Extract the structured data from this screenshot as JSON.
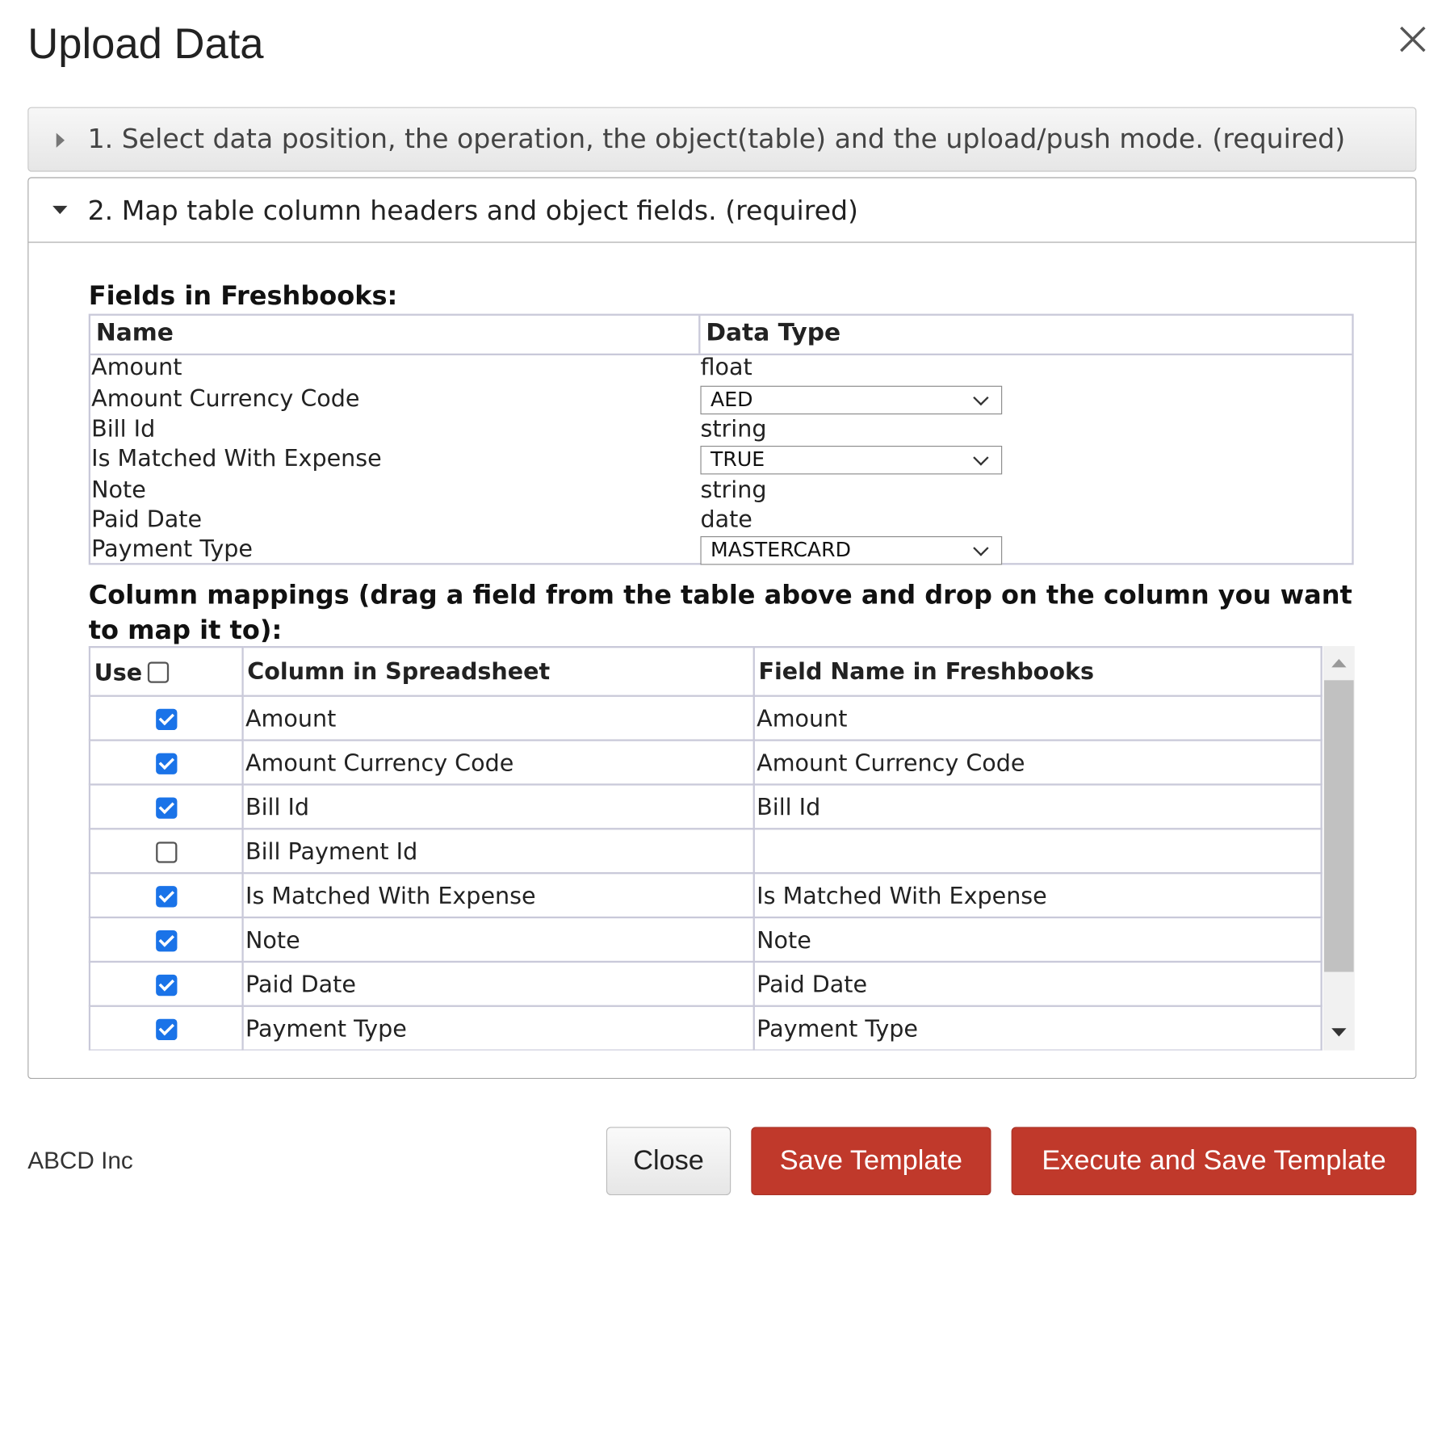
{
  "dialog": {
    "title": "Upload Data"
  },
  "steps": [
    {
      "label": "1. Select data position, the operation, the object(table) and the upload/push mode. (required)",
      "expanded": false
    },
    {
      "label": "2. Map table column headers and object fields. (required)",
      "expanded": true
    }
  ],
  "fields_section": {
    "title": "Fields in Freshbooks:",
    "headers": {
      "name": "Name",
      "type": "Data Type"
    },
    "rows": [
      {
        "name": "Amount",
        "type": "float"
      },
      {
        "name": "Amount Currency Code",
        "select": "AED"
      },
      {
        "name": "Bill Id",
        "type": "string"
      },
      {
        "name": "Is Matched With Expense",
        "select": "TRUE"
      },
      {
        "name": "Note",
        "type": "string"
      },
      {
        "name": "Paid Date",
        "type": "date"
      },
      {
        "name": "Payment Type",
        "select": "MASTERCARD"
      }
    ]
  },
  "mappings_section": {
    "title": "Column mappings (drag a field from the table above and drop on the column you want to map it to):",
    "headers": {
      "use": "Use",
      "column": "Column in Spreadsheet",
      "field": "Field Name in Freshbooks"
    },
    "use_all_checked": false,
    "rows": [
      {
        "checked": true,
        "column": "Amount",
        "field": "Amount"
      },
      {
        "checked": true,
        "column": "Amount Currency Code",
        "field": "Amount Currency Code"
      },
      {
        "checked": true,
        "column": "Bill Id",
        "field": "Bill Id"
      },
      {
        "checked": false,
        "column": "Bill Payment Id",
        "field": ""
      },
      {
        "checked": true,
        "column": "Is Matched With Expense",
        "field": "Is Matched With Expense"
      },
      {
        "checked": true,
        "column": "Note",
        "field": "Note"
      },
      {
        "checked": true,
        "column": "Paid Date",
        "field": "Paid Date"
      },
      {
        "checked": true,
        "column": "Payment Type",
        "field": "Payment Type"
      }
    ]
  },
  "footer": {
    "company": "ABCD Inc",
    "close_label": "Close",
    "save_label": "Save Template",
    "execute_label": "Execute and Save Template"
  },
  "colors": {
    "accent_red": "#c0392b",
    "checkbox_blue": "#1a73e8"
  }
}
